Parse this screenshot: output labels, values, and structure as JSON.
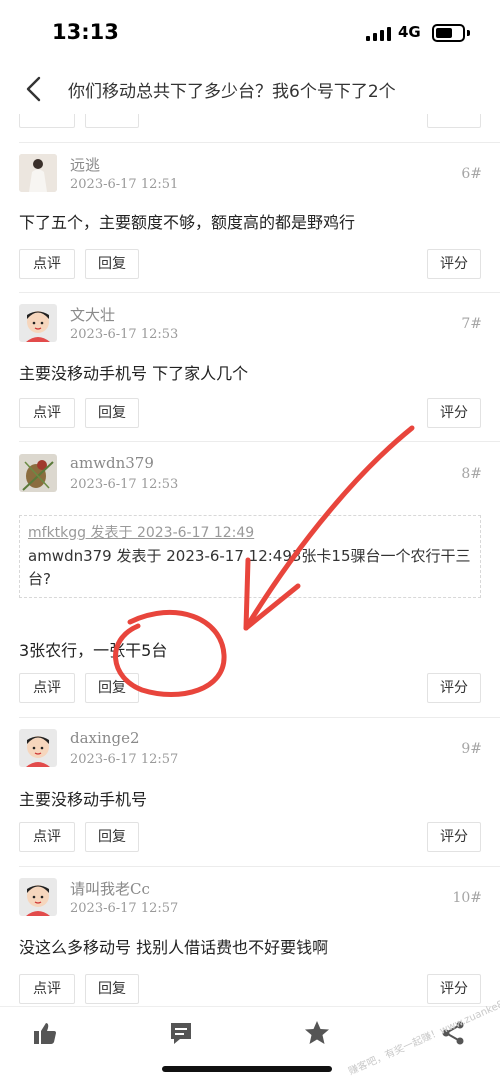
{
  "status_bar": {
    "time": "13:13",
    "network": "4G"
  },
  "nav": {
    "title": "你们移动总共下了多少台？我6个号下了2个"
  },
  "buttons": {
    "comment": "点评",
    "reply": "回复",
    "rate": "评分"
  },
  "posts": [
    {
      "username": "远逃",
      "timestamp": "2023-6-17 12:51",
      "floor": "6#",
      "content": "下了五个，主要额度不够，额度高的都是野鸡行"
    },
    {
      "username": "文大壮",
      "timestamp": "2023-6-17 12:53",
      "floor": "7#",
      "content": "主要没移动手机号    下了家人几个"
    },
    {
      "username": "amwdn379",
      "timestamp": "2023-6-17 12:53",
      "floor": "8#",
      "quote": {
        "header": "mfktkgg 发表于 2023-6-17 12:49",
        "body": "amwdn379 发表于 2023-6-17 12:493张卡15骒台一个农行干三台?"
      },
      "content": "3张农行，一张干5台"
    },
    {
      "username": "daxinge2",
      "timestamp": "2023-6-17 12:57",
      "floor": "9#",
      "content": "主要没移动手机号"
    },
    {
      "username": "请叫我老Cc",
      "timestamp": "2023-6-17 12:57",
      "floor": "10#",
      "content": "没这么多移动号 找别人借话费也不好要钱啊"
    }
  ],
  "bottom_bar": {
    "icons": [
      "thumbs-up-icon",
      "comment-icon",
      "star-icon",
      "share-icon"
    ]
  },
  "watermark": "赚客吧，有奖一起赚！www.zuanke8.com",
  "colors": {
    "annotation": "#e8453c",
    "text_primary": "#222222",
    "text_meta": "#9a9a9a",
    "border": "#e2e2e2"
  }
}
